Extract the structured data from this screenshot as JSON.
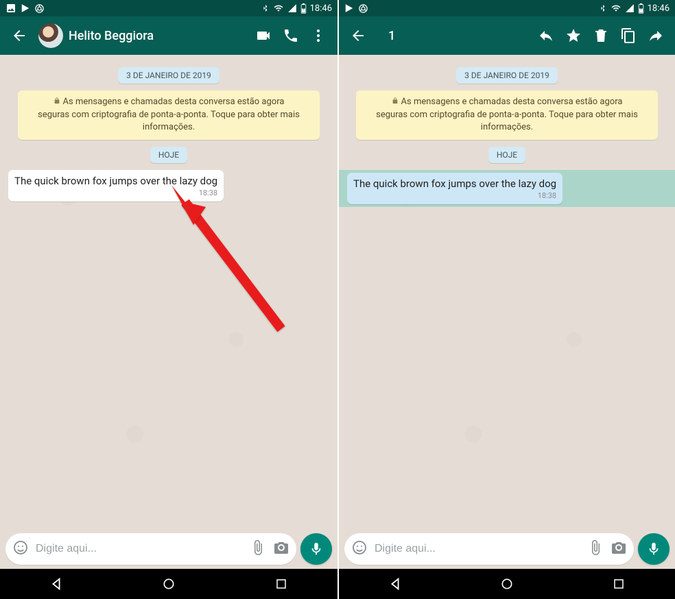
{
  "status": {
    "time": "18:46"
  },
  "left": {
    "contact_name": "Helito Beggiora",
    "date_chip": "3 DE JANEIRO DE 2019",
    "encryption_text": "As mensagens e chamadas desta conversa estão agora seguras com criptografia de ponta-a-ponta. Toque para obter mais informações.",
    "today_chip": "HOJE",
    "message_text": "The quick brown fox jumps over the lazy dog",
    "message_time": "18:38",
    "input_placeholder": "Digite aqui..."
  },
  "right": {
    "selection_count": "1",
    "date_chip": "3 DE JANEIRO DE 2019",
    "encryption_text": "As mensagens e chamadas desta conversa estão agora seguras com criptografia de ponta-a-ponta. Toque para obter mais informações.",
    "today_chip": "HOJE",
    "message_text": "The quick brown fox jumps over the lazy dog",
    "message_time": "18:38",
    "input_placeholder": "Digite aqui..."
  }
}
